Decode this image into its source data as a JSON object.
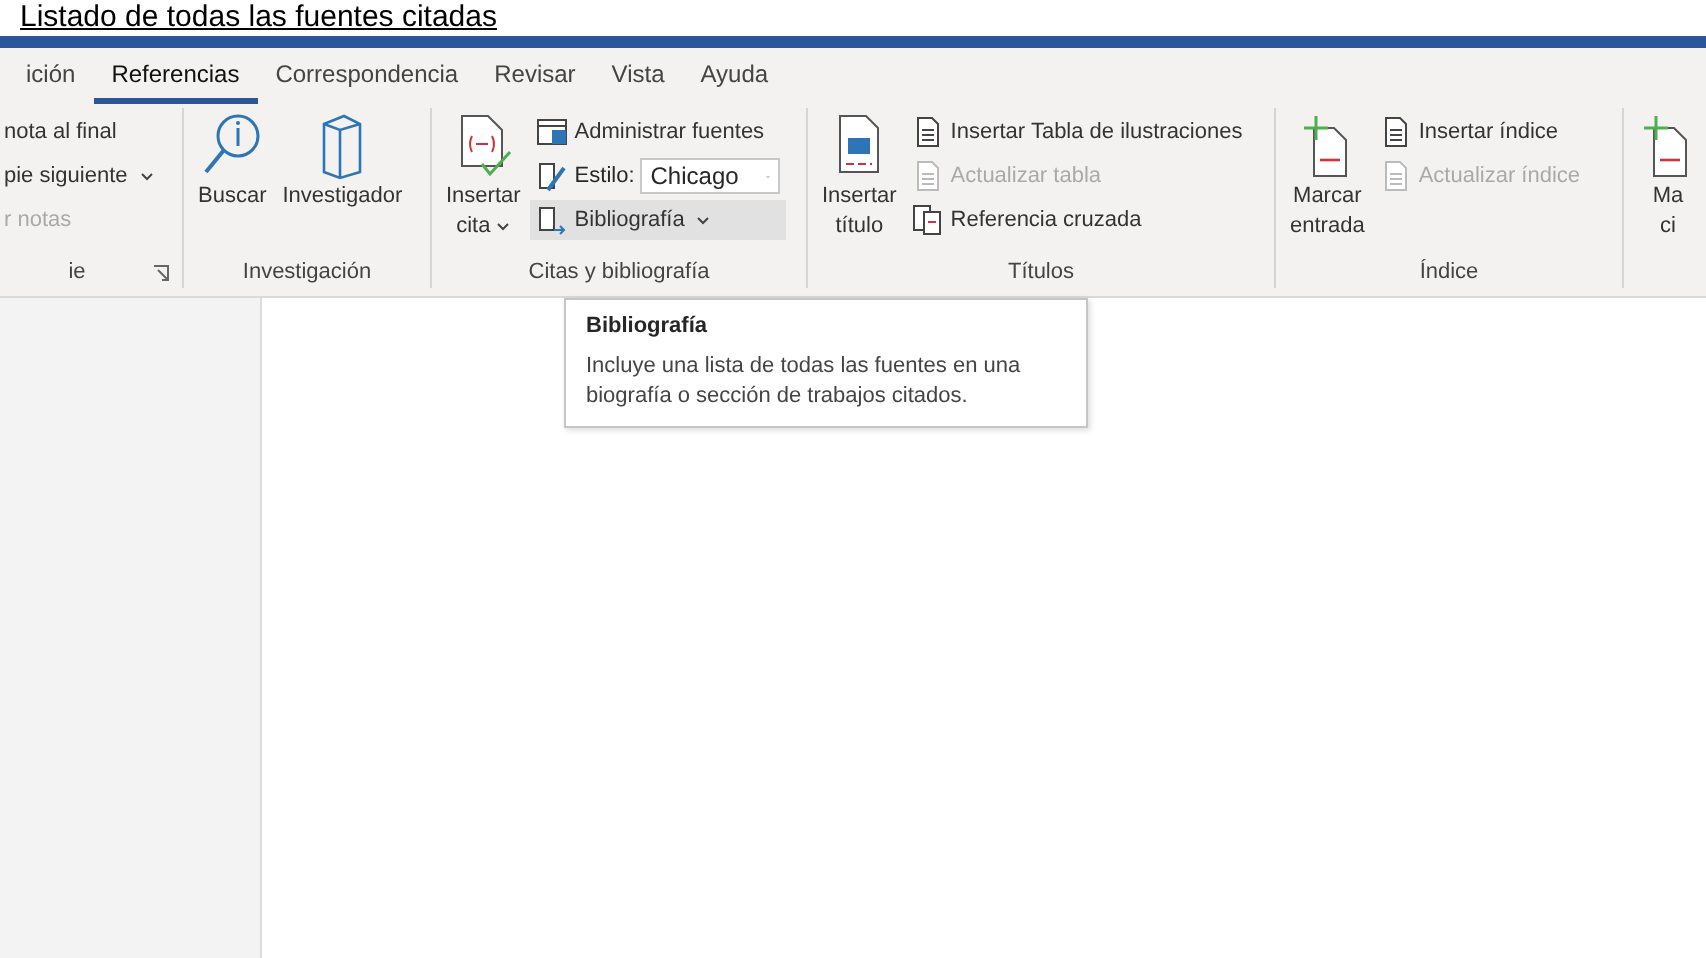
{
  "document_heading": "Listado de todas las fuentes citadas",
  "tabs": [
    {
      "label": "ición",
      "selected": false
    },
    {
      "label": "Referencias",
      "selected": true
    },
    {
      "label": "Correspondencia",
      "selected": false
    },
    {
      "label": "Revisar",
      "selected": false
    },
    {
      "label": "Vista",
      "selected": false
    },
    {
      "label": "Ayuda",
      "selected": false
    }
  ],
  "groups": [
    {
      "label": "ie",
      "launcher": true,
      "columns": [
        {
          "kind": "stack",
          "items": [
            {
              "kind": "small",
              "label": "nota al final",
              "disabled": false
            },
            {
              "kind": "small",
              "label": "pie siguiente",
              "disabled": false,
              "caret": true
            },
            {
              "kind": "small",
              "label": "r notas",
              "disabled": true
            }
          ]
        }
      ]
    },
    {
      "label": "Investigación",
      "columns": [
        {
          "kind": "large",
          "lines": [
            "Buscar"
          ]
        },
        {
          "kind": "large",
          "lines": [
            "Investigador"
          ]
        }
      ]
    },
    {
      "label": "Citas y bibliografía",
      "columns": [
        {
          "kind": "large",
          "lines": [
            "Insertar",
            "cita"
          ],
          "caret": true
        },
        {
          "kind": "stack",
          "items": [
            {
              "kind": "small",
              "label": "Administrar fuentes",
              "disabled": false
            },
            {
              "kind": "combo",
              "label": "Estilo:",
              "value": "Chicago"
            },
            {
              "kind": "small",
              "label": "Bibliografía",
              "disabled": false,
              "caret": true,
              "selected": true
            }
          ]
        }
      ]
    },
    {
      "label": "Títulos",
      "columns": [
        {
          "kind": "large",
          "lines": [
            "Insertar",
            "título"
          ]
        },
        {
          "kind": "stack",
          "items": [
            {
              "kind": "small",
              "label": "Insertar Tabla de ilustraciones",
              "disabled": false
            },
            {
              "kind": "small",
              "label": "Actualizar tabla",
              "disabled": true
            },
            {
              "kind": "small",
              "label": "Referencia cruzada",
              "disabled": false
            }
          ]
        }
      ]
    },
    {
      "label": "Índice",
      "columns": [
        {
          "kind": "large",
          "lines": [
            "Marcar",
            "entrada"
          ]
        },
        {
          "kind": "stack",
          "items": [
            {
              "kind": "small",
              "label": "Insertar índice",
              "disabled": false
            },
            {
              "kind": "small",
              "label": "Actualizar índice",
              "disabled": true
            }
          ]
        }
      ]
    },
    {
      "columns": [
        {
          "kind": "large",
          "lines": [
            "Ma",
            "ci"
          ]
        }
      ]
    }
  ],
  "tooltip": {
    "title": "Bibliografía",
    "text": "Incluye una lista de todas las fuentes en una biografía o sección de trabajos citados."
  }
}
